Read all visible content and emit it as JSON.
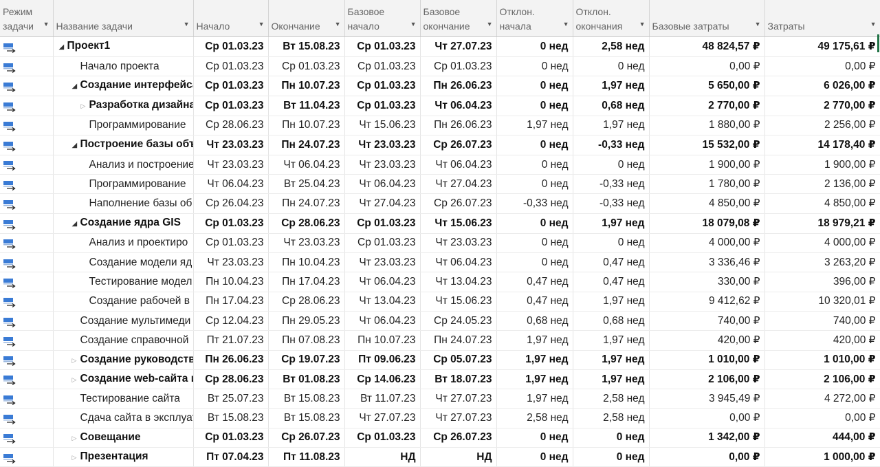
{
  "columns": [
    {
      "label": "Режим\nзадачи",
      "line1": "Режим",
      "line2": "задачи"
    },
    {
      "line1": "",
      "line2": "Название задачи"
    },
    {
      "line1": "",
      "line2": "Начало"
    },
    {
      "line1": "",
      "line2": "Окончание"
    },
    {
      "line1": "Базовое",
      "line2": "начало"
    },
    {
      "line1": "Базовое",
      "line2": "окончание"
    },
    {
      "line1": "Отклон.",
      "line2": "начала"
    },
    {
      "line1": "Отклон.",
      "line2": "окончания"
    },
    {
      "line1": "",
      "line2": "Базовые затраты"
    },
    {
      "line1": "",
      "line2": "Затраты"
    }
  ],
  "colors": {
    "mode_icon_blue": "#3a7bd5",
    "mode_icon_arrow": "#2a2a2a",
    "accent_green": "#217346"
  },
  "icons": {
    "mode": "auto-scheduled-task-icon",
    "expanded": "triangle-down-icon",
    "collapsed": "triangle-right-icon"
  },
  "rows": [
    {
      "name": "Проект1",
      "level": 0,
      "toggle": "expanded",
      "summary": true,
      "start": "Ср 01.03.23",
      "finish": "Вт 15.08.23",
      "bstart": "Ср 01.03.23",
      "bfinish": "Чт 27.07.23",
      "sv": "0 нед",
      "fv": "2,58 нед",
      "bcost": "48 824,57 ₽",
      "cost": "49 175,61 ₽"
    },
    {
      "name": "Начало проекта",
      "level": 1,
      "toggle": "none",
      "summary": false,
      "start": "Ср 01.03.23",
      "finish": "Ср 01.03.23",
      "bstart": "Ср 01.03.23",
      "bfinish": "Ср 01.03.23",
      "sv": "0 нед",
      "fv": "0 нед",
      "bcost": "0,00 ₽",
      "cost": "0,00 ₽"
    },
    {
      "name": "Создание интерфейса",
      "level": 1,
      "toggle": "expanded",
      "summary": true,
      "start": "Ср 01.03.23",
      "finish": "Пн 10.07.23",
      "bstart": "Ср 01.03.23",
      "bfinish": "Пн 26.06.23",
      "sv": "0 нед",
      "fv": "1,97 нед",
      "bcost": "5 650,00 ₽",
      "cost": "6 026,00 ₽"
    },
    {
      "name": "Разработка дизайна",
      "level": 2,
      "toggle": "collapsed",
      "summary": true,
      "start": "Ср 01.03.23",
      "finish": "Вт 11.04.23",
      "bstart": "Ср 01.03.23",
      "bfinish": "Чт 06.04.23",
      "sv": "0 нед",
      "fv": "0,68 нед",
      "bcost": "2 770,00 ₽",
      "cost": "2 770,00 ₽"
    },
    {
      "name": "Программирование",
      "level": 2,
      "toggle": "none",
      "summary": false,
      "start": "Ср 28.06.23",
      "finish": "Пн 10.07.23",
      "bstart": "Чт 15.06.23",
      "bfinish": "Пн 26.06.23",
      "sv": "1,97 нед",
      "fv": "1,97 нед",
      "bcost": "1 880,00 ₽",
      "cost": "2 256,00 ₽"
    },
    {
      "name": "Построение базы объ",
      "level": 1,
      "toggle": "expanded",
      "summary": true,
      "start": "Чт 23.03.23",
      "finish": "Пн 24.07.23",
      "bstart": "Чт 23.03.23",
      "bfinish": "Ср 26.07.23",
      "sv": "0 нед",
      "fv": "-0,33 нед",
      "bcost": "15 532,00 ₽",
      "cost": "14 178,40 ₽"
    },
    {
      "name": "Анализ и построение",
      "level": 2,
      "toggle": "none",
      "summary": false,
      "start": "Чт 23.03.23",
      "finish": "Чт 06.04.23",
      "bstart": "Чт 23.03.23",
      "bfinish": "Чт 06.04.23",
      "sv": "0 нед",
      "fv": "0 нед",
      "bcost": "1 900,00 ₽",
      "cost": "1 900,00 ₽"
    },
    {
      "name": "Программирование",
      "level": 2,
      "toggle": "none",
      "summary": false,
      "start": "Чт 06.04.23",
      "finish": "Вт 25.04.23",
      "bstart": "Чт 06.04.23",
      "bfinish": "Чт 27.04.23",
      "sv": "0 нед",
      "fv": "-0,33 нед",
      "bcost": "1 780,00 ₽",
      "cost": "2 136,00 ₽"
    },
    {
      "name": "Наполнение базы об",
      "level": 2,
      "toggle": "none",
      "summary": false,
      "start": "Ср 26.04.23",
      "finish": "Пн 24.07.23",
      "bstart": "Чт 27.04.23",
      "bfinish": "Ср 26.07.23",
      "sv": "-0,33 нед",
      "fv": "-0,33 нед",
      "bcost": "4 850,00 ₽",
      "cost": "4 850,00 ₽"
    },
    {
      "name": "Создание ядра GIS",
      "level": 1,
      "toggle": "expanded",
      "summary": true,
      "start": "Ср 01.03.23",
      "finish": "Ср 28.06.23",
      "bstart": "Ср 01.03.23",
      "bfinish": "Чт 15.06.23",
      "sv": "0 нед",
      "fv": "1,97 нед",
      "bcost": "18 079,08 ₽",
      "cost": "18 979,21 ₽"
    },
    {
      "name": "Анализ и проектиро",
      "level": 2,
      "toggle": "none",
      "summary": false,
      "start": "Ср 01.03.23",
      "finish": "Чт 23.03.23",
      "bstart": "Ср 01.03.23",
      "bfinish": "Чт 23.03.23",
      "sv": "0 нед",
      "fv": "0 нед",
      "bcost": "4 000,00 ₽",
      "cost": "4 000,00 ₽"
    },
    {
      "name": "Создание модели яд",
      "level": 2,
      "toggle": "none",
      "summary": false,
      "start": "Чт 23.03.23",
      "finish": "Пн 10.04.23",
      "bstart": "Чт 23.03.23",
      "bfinish": "Чт 06.04.23",
      "sv": "0 нед",
      "fv": "0,47 нед",
      "bcost": "3 336,46 ₽",
      "cost": "3 263,20 ₽"
    },
    {
      "name": "Тестирование модел",
      "level": 2,
      "toggle": "none",
      "summary": false,
      "start": "Пн 10.04.23",
      "finish": "Пн 17.04.23",
      "bstart": "Чт 06.04.23",
      "bfinish": "Чт 13.04.23",
      "sv": "0,47 нед",
      "fv": "0,47 нед",
      "bcost": "330,00 ₽",
      "cost": "396,00 ₽"
    },
    {
      "name": "Создание рабочей в",
      "level": 2,
      "toggle": "none",
      "summary": false,
      "start": "Пн 17.04.23",
      "finish": "Ср 28.06.23",
      "bstart": "Чт 13.04.23",
      "bfinish": "Чт 15.06.23",
      "sv": "0,47 нед",
      "fv": "1,97 нед",
      "bcost": "9 412,62 ₽",
      "cost": "10 320,01 ₽"
    },
    {
      "name": "Создание мультимеди",
      "level": 1,
      "toggle": "none",
      "summary": false,
      "start": "Ср 12.04.23",
      "finish": "Пн 29.05.23",
      "bstart": "Чт 06.04.23",
      "bfinish": "Ср 24.05.23",
      "sv": "0,68 нед",
      "fv": "0,68 нед",
      "bcost": "740,00 ₽",
      "cost": "740,00 ₽"
    },
    {
      "name": "Создание справочной",
      "level": 1,
      "toggle": "none",
      "summary": false,
      "start": "Пт 21.07.23",
      "finish": "Пн 07.08.23",
      "bstart": "Пн 10.07.23",
      "bfinish": "Пн 24.07.23",
      "sv": "1,97 нед",
      "fv": "1,97 нед",
      "bcost": "420,00 ₽",
      "cost": "420,00 ₽"
    },
    {
      "name": "Создание руководств",
      "level": 1,
      "toggle": "collapsed",
      "summary": true,
      "start": "Пн 26.06.23",
      "finish": "Ср 19.07.23",
      "bstart": "Пт 09.06.23",
      "bfinish": "Ср 05.07.23",
      "sv": "1,97 нед",
      "fv": "1,97 нед",
      "bcost": "1 010,00 ₽",
      "cost": "1 010,00 ₽"
    },
    {
      "name": "Создание web-сайта и",
      "level": 1,
      "toggle": "collapsed",
      "summary": true,
      "start": "Ср 28.06.23",
      "finish": "Вт 01.08.23",
      "bstart": "Ср 14.06.23",
      "bfinish": "Вт 18.07.23",
      "sv": "1,97 нед",
      "fv": "1,97 нед",
      "bcost": "2 106,00 ₽",
      "cost": "2 106,00 ₽"
    },
    {
      "name": "Тестирование сайта",
      "level": 1,
      "toggle": "none",
      "summary": false,
      "start": "Вт 25.07.23",
      "finish": "Вт 15.08.23",
      "bstart": "Вт 11.07.23",
      "bfinish": "Чт 27.07.23",
      "sv": "1,97 нед",
      "fv": "2,58 нед",
      "bcost": "3 945,49 ₽",
      "cost": "4 272,00 ₽"
    },
    {
      "name": "Сдача сайта в эксплуат",
      "level": 1,
      "toggle": "none",
      "summary": false,
      "start": "Вт 15.08.23",
      "finish": "Вт 15.08.23",
      "bstart": "Чт 27.07.23",
      "bfinish": "Чт 27.07.23",
      "sv": "2,58 нед",
      "fv": "2,58 нед",
      "bcost": "0,00 ₽",
      "cost": "0,00 ₽"
    },
    {
      "name": "Совещание",
      "level": 1,
      "toggle": "collapsed",
      "summary": true,
      "start": "Ср 01.03.23",
      "finish": "Ср 26.07.23",
      "bstart": "Ср 01.03.23",
      "bfinish": "Ср 26.07.23",
      "sv": "0 нед",
      "fv": "0 нед",
      "bcost": "1 342,00 ₽",
      "cost": "444,00 ₽"
    },
    {
      "name": "Презентация",
      "level": 1,
      "toggle": "collapsed",
      "summary": true,
      "start": "Пт 07.04.23",
      "finish": "Пт 11.08.23",
      "bstart": "НД",
      "bfinish": "НД",
      "sv": "0 нед",
      "fv": "0 нед",
      "bcost": "0,00 ₽",
      "cost": "1 000,00 ₽"
    }
  ]
}
